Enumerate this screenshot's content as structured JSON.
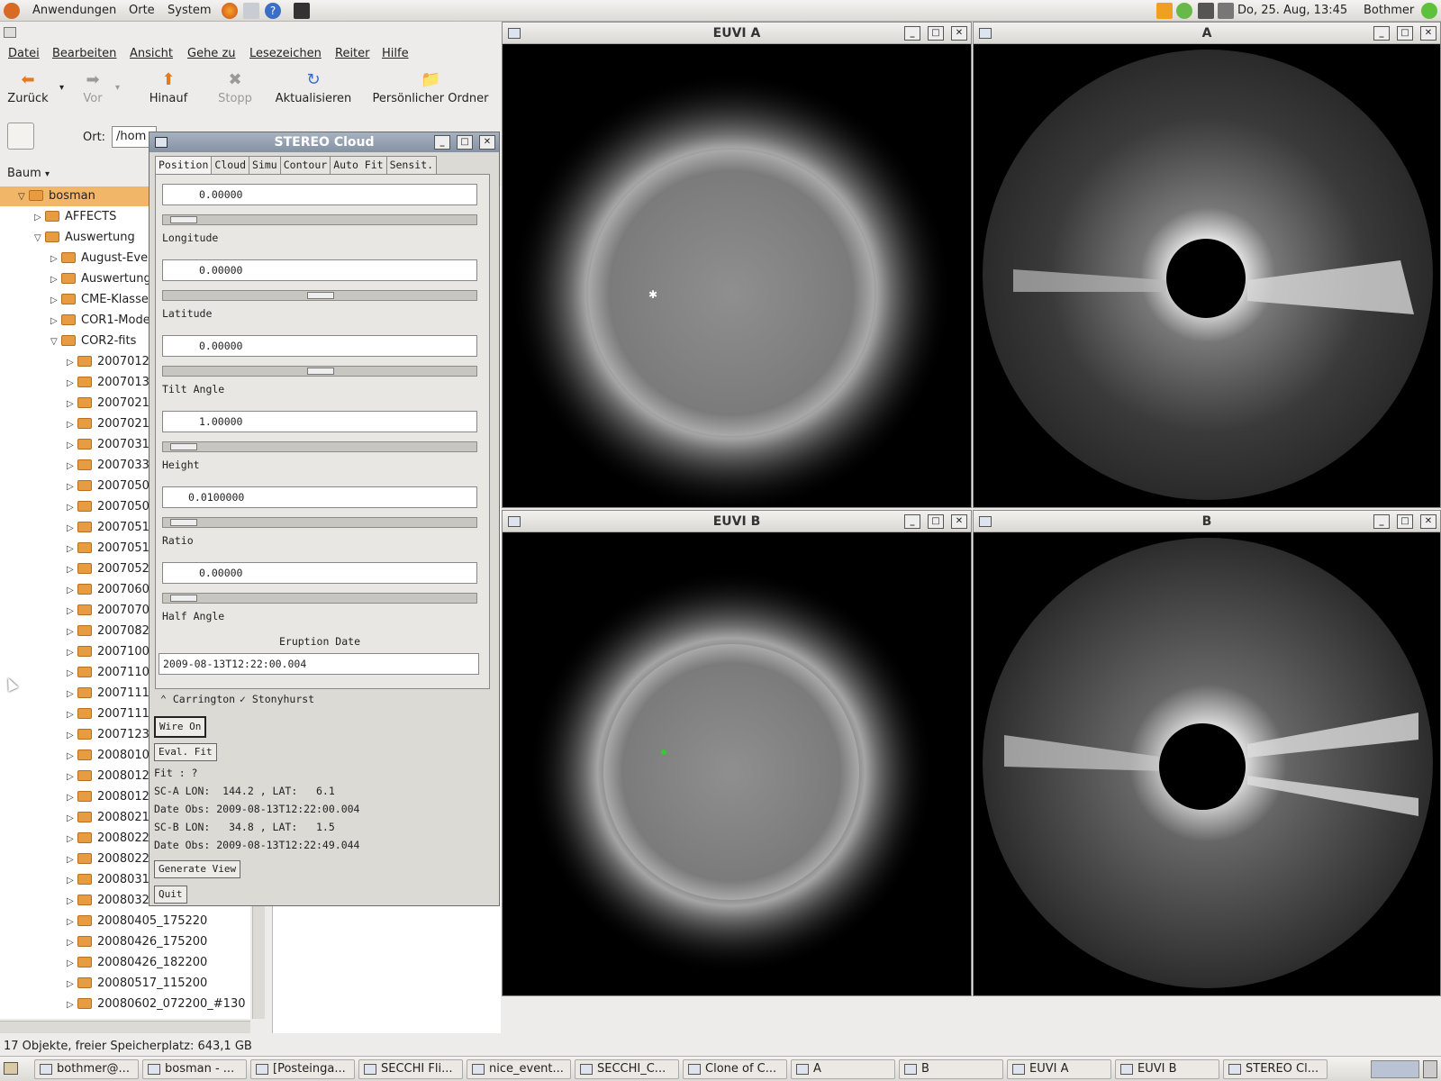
{
  "top_panel": {
    "menus": [
      "Anwendungen",
      "Orte",
      "System"
    ],
    "clock": "Do, 25. Aug, 13:45",
    "user": "Bothmer"
  },
  "file_manager": {
    "menus": [
      "Datei",
      "Bearbeiten",
      "Ansicht",
      "Gehe zu",
      "Lesezeichen",
      "Reiter",
      "Hilfe"
    ],
    "toolbar": [
      "Zurück",
      "Vor",
      "Hinauf",
      "Stopp",
      "Aktualisieren",
      "Persönlicher Ordner"
    ],
    "location_label": "Ort:",
    "location_value": "/hom",
    "sidebar_mode": "Baum",
    "tree": [
      {
        "label": "bosman",
        "indent": 0,
        "open": true,
        "selected": true
      },
      {
        "label": "AFFECTS",
        "indent": 1,
        "open": false
      },
      {
        "label": "Auswertung",
        "indent": 1,
        "open": true
      },
      {
        "label": "August-Eve",
        "indent": 2,
        "open": false
      },
      {
        "label": "Auswertung",
        "indent": 2,
        "open": false
      },
      {
        "label": "CME-Klasse",
        "indent": 2,
        "open": false
      },
      {
        "label": "COR1-Mode",
        "indent": 2,
        "open": false
      },
      {
        "label": "COR2-fits",
        "indent": 2,
        "open": true
      },
      {
        "label": "2007012",
        "indent": 3
      },
      {
        "label": "2007013",
        "indent": 3
      },
      {
        "label": "2007021",
        "indent": 3
      },
      {
        "label": "2007021",
        "indent": 3
      },
      {
        "label": "2007031",
        "indent": 3
      },
      {
        "label": "2007033",
        "indent": 3
      },
      {
        "label": "2007050",
        "indent": 3
      },
      {
        "label": "2007050",
        "indent": 3
      },
      {
        "label": "2007051",
        "indent": 3
      },
      {
        "label": "2007051",
        "indent": 3
      },
      {
        "label": "2007052",
        "indent": 3
      },
      {
        "label": "2007060",
        "indent": 3
      },
      {
        "label": "2007070",
        "indent": 3
      },
      {
        "label": "2007082",
        "indent": 3
      },
      {
        "label": "2007100",
        "indent": 3
      },
      {
        "label": "2007110",
        "indent": 3
      },
      {
        "label": "2007111",
        "indent": 3
      },
      {
        "label": "2007111",
        "indent": 3
      },
      {
        "label": "2007123",
        "indent": 3
      },
      {
        "label": "2008010",
        "indent": 3
      },
      {
        "label": "2008012",
        "indent": 3
      },
      {
        "label": "2008012",
        "indent": 3
      },
      {
        "label": "2008021",
        "indent": 3
      },
      {
        "label": "2008022",
        "indent": 3
      },
      {
        "label": "2008022",
        "indent": 3
      },
      {
        "label": "2008031",
        "indent": 3
      },
      {
        "label": "2008032",
        "indent": 3
      },
      {
        "label": "20080405_175220",
        "indent": 3
      },
      {
        "label": "20080426_175200",
        "indent": 3
      },
      {
        "label": "20080426_182200",
        "indent": 3
      },
      {
        "label": "20080517_115200",
        "indent": 3
      },
      {
        "label": "20080602_072200_#130",
        "indent": 3
      }
    ],
    "status": "17 Objekte, freier Speicherplatz: 643,1 GB"
  },
  "stereo_cloud": {
    "title": "STEREO Cloud",
    "tabs": [
      "Position",
      "Cloud",
      "Simu",
      "Contour",
      "Auto Fit",
      "Sensit."
    ],
    "fields": [
      {
        "value": "0.00000",
        "label": "Longitude",
        "knob": 0.02
      },
      {
        "value": "0.00000",
        "label": "Latitude",
        "knob": 0.5
      },
      {
        "value": "0.00000",
        "label": "Tilt Angle",
        "knob": 0.5
      },
      {
        "value": "1.00000",
        "label": "Height",
        "knob": 0.02
      },
      {
        "value": "0.0100000",
        "label": "Ratio",
        "knob": 0.02
      },
      {
        "value": "0.00000",
        "label": "Half Angle",
        "knob": 0.02
      }
    ],
    "eruption_label": "Eruption Date",
    "eruption_value": "2009-08-13T12:22:00.004",
    "radio": [
      "Carrington",
      "Stonyhurst"
    ],
    "buttons": {
      "wire": "Wire On",
      "eval": "Eval. Fit",
      "generate": "Generate View",
      "quit": "Quit"
    },
    "info": [
      "Fit : ?",
      "SC-A LON:  144.2 , LAT:   6.1",
      "Date Obs: 2009-08-13T12:22:00.004",
      "SC-B LON:   34.8 , LAT:   1.5",
      "Date Obs: 2009-08-13T12:22:49.044"
    ]
  },
  "windows": {
    "euvi_a": "EUVI A",
    "cor_a": "A",
    "euvi_b": "EUVI B",
    "cor_b": "B"
  },
  "taskbar": [
    "bothmer@...",
    "bosman - ...",
    "[Posteinga...",
    "SECCHI Fli...",
    "nice_event...",
    "SECCHI_C...",
    "Clone of C...",
    "A",
    "B",
    "EUVI A",
    "EUVI B",
    "STEREO Cl..."
  ]
}
